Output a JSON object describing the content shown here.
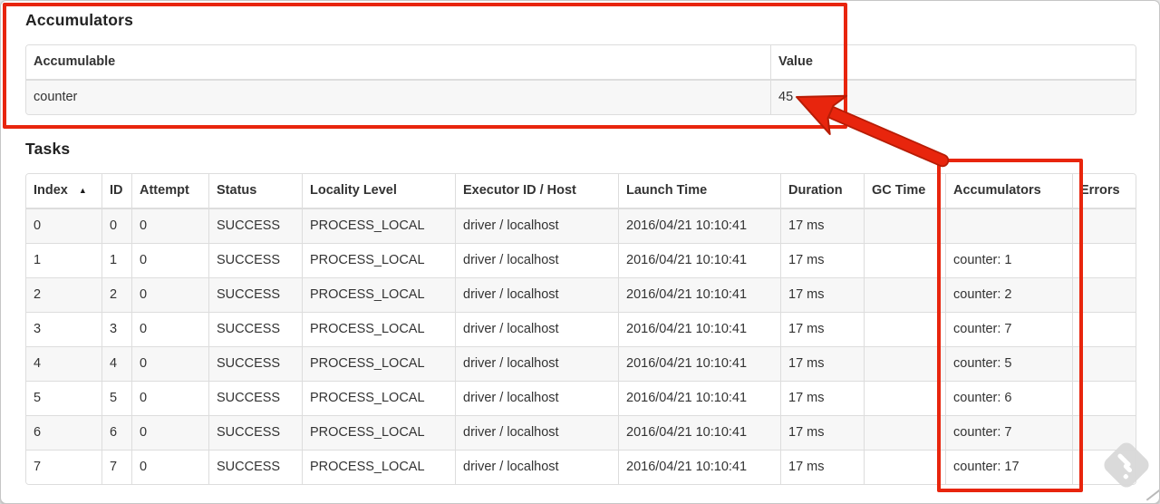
{
  "colors": {
    "annotation_red": "#e8250d",
    "annotation_red_dark": "#b71c05",
    "stripe_gray": "#f7f7f7",
    "table_border": "#dddddd"
  },
  "accumulators_section": {
    "heading": "Accumulators",
    "table": {
      "col_accumulable": "Accumulable",
      "col_value": "Value",
      "row": {
        "accumulable": "counter",
        "value": "45"
      }
    }
  },
  "tasks_section": {
    "heading": "Tasks",
    "sort_icon": "▲",
    "headers": [
      "Index",
      "ID",
      "Attempt",
      "Status",
      "Locality Level",
      "Executor ID / Host",
      "Launch Time",
      "Duration",
      "GC Time",
      "Accumulators",
      "Errors"
    ],
    "rows": [
      [
        "0",
        "0",
        "0",
        "SUCCESS",
        "PROCESS_LOCAL",
        "driver / localhost",
        "2016/04/21 10:10:41",
        "17 ms",
        "",
        "",
        ""
      ],
      [
        "1",
        "1",
        "0",
        "SUCCESS",
        "PROCESS_LOCAL",
        "driver / localhost",
        "2016/04/21 10:10:41",
        "17 ms",
        "",
        "counter: 1",
        ""
      ],
      [
        "2",
        "2",
        "0",
        "SUCCESS",
        "PROCESS_LOCAL",
        "driver / localhost",
        "2016/04/21 10:10:41",
        "17 ms",
        "",
        "counter: 2",
        ""
      ],
      [
        "3",
        "3",
        "0",
        "SUCCESS",
        "PROCESS_LOCAL",
        "driver / localhost",
        "2016/04/21 10:10:41",
        "17 ms",
        "",
        "counter: 7",
        ""
      ],
      [
        "4",
        "4",
        "0",
        "SUCCESS",
        "PROCESS_LOCAL",
        "driver / localhost",
        "2016/04/21 10:10:41",
        "17 ms",
        "",
        "counter: 5",
        ""
      ],
      [
        "5",
        "5",
        "0",
        "SUCCESS",
        "PROCESS_LOCAL",
        "driver / localhost",
        "2016/04/21 10:10:41",
        "17 ms",
        "",
        "counter: 6",
        ""
      ],
      [
        "6",
        "6",
        "0",
        "SUCCESS",
        "PROCESS_LOCAL",
        "driver / localhost",
        "2016/04/21 10:10:41",
        "17 ms",
        "",
        "counter: 7",
        ""
      ],
      [
        "7",
        "7",
        "0",
        "SUCCESS",
        "PROCESS_LOCAL",
        "driver / localhost",
        "2016/04/21 10:10:41",
        "17 ms",
        "",
        "counter: 17",
        ""
      ]
    ]
  }
}
